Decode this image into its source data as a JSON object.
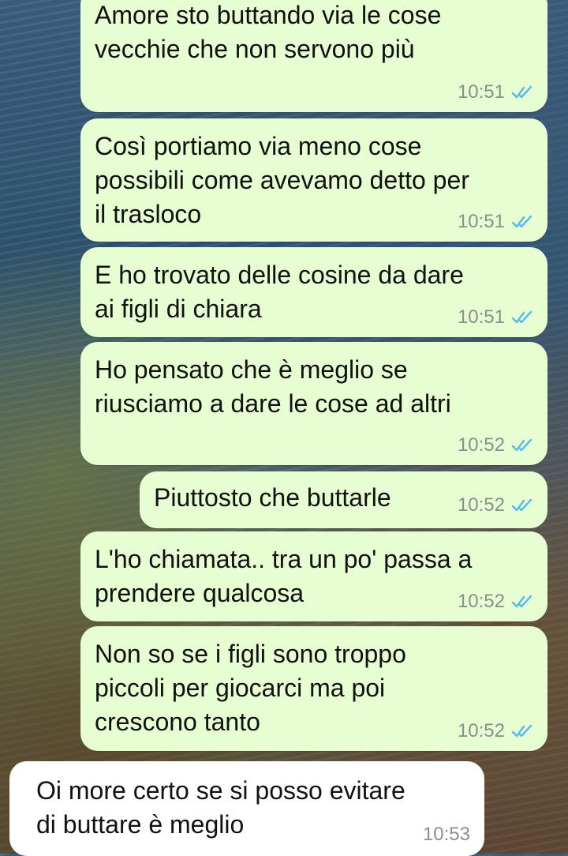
{
  "colors": {
    "outgoing_bubble": "#e7fed3",
    "incoming_bubble": "#ffffff",
    "read_tick": "#53bdeb",
    "time_text": "#8a8f8c"
  },
  "messages": [
    {
      "direction": "outgoing",
      "text": "Amore sto buttando via le cose\nvecchie che non servono più",
      "time": "10:51",
      "status_icon": "double-check-read-icon"
    },
    {
      "direction": "outgoing",
      "text": "Così portiamo via meno cose\npossibili come avevamo detto per\nil trasloco",
      "time": "10:51",
      "status_icon": "double-check-read-icon"
    },
    {
      "direction": "outgoing",
      "text": "E ho trovato delle cosine da dare\nai figli di chiara",
      "time": "10:51",
      "status_icon": "double-check-read-icon"
    },
    {
      "direction": "outgoing",
      "text": "Ho pensato che è meglio se\nriusciamo a dare le cose ad altri",
      "time": "10:52",
      "status_icon": "double-check-read-icon"
    },
    {
      "direction": "outgoing",
      "text": "Piuttosto che buttarle",
      "time": "10:52",
      "status_icon": "double-check-read-icon"
    },
    {
      "direction": "outgoing",
      "text": "L'ho chiamata.. tra un po' passa a\nprendere qualcosa",
      "time": "10:52",
      "status_icon": "double-check-read-icon"
    },
    {
      "direction": "outgoing",
      "text": "Non so se i figli sono troppo\npiccoli per giocarci ma poi\ncrescono tanto",
      "time": "10:52",
      "status_icon": "double-check-read-icon"
    },
    {
      "direction": "incoming",
      "text": "Oi more certo se si posso evitare\ndi buttare è meglio",
      "time": "10:53"
    }
  ]
}
